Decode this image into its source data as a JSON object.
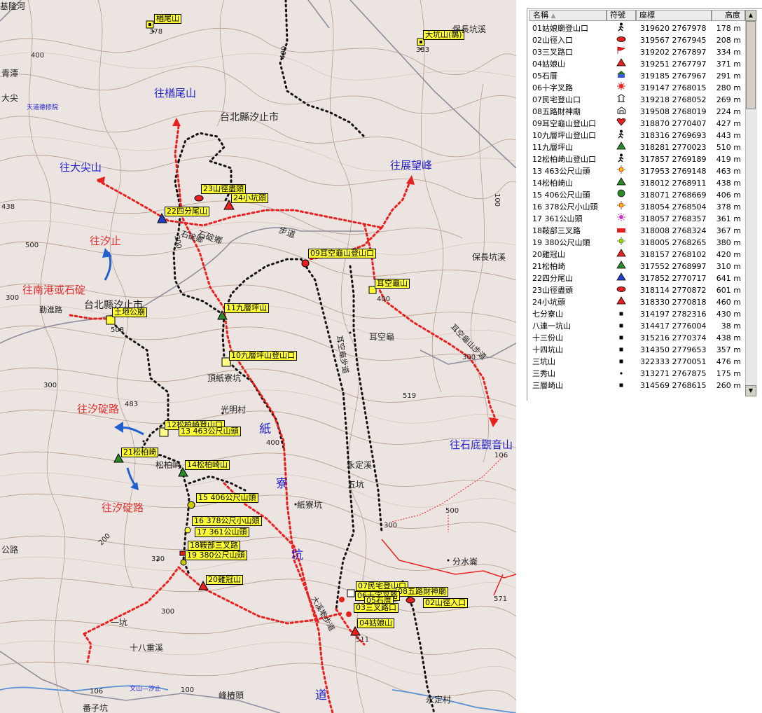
{
  "map": {
    "region_labels": [
      "台北縣汐止市",
      "台北縣汐止市",
      "石碇鄉"
    ],
    "places": [
      "基隆河",
      "保長坑溪",
      "保長坑溪",
      "耳空龜",
      "頂紙寮坑",
      "光明村",
      "松柏崎",
      "永定溪",
      "五坑",
      "紙寮坑",
      "分水崙",
      "十八重溪",
      "峰樁頭",
      "番子坑",
      "永定村",
      "一坑",
      "勤進路",
      "公路",
      "大尖",
      "青潭",
      "步道",
      "石碇鄉",
      "耳空龜步道",
      "大溪墘步道",
      "耳空龜山步道",
      "天道德修院",
      "文山—汐止"
    ],
    "directions": [
      {
        "text": "往楢尾山",
        "color": "blue"
      },
      {
        "text": "往大尖山",
        "color": "blue"
      },
      {
        "text": "往展望峰",
        "color": "blue"
      },
      {
        "text": "往汐止",
        "color": "red"
      },
      {
        "text": "往南港或石碇",
        "color": "red"
      },
      {
        "text": "往汐碇路",
        "color": "red"
      },
      {
        "text": "往汐碇路",
        "color": "red"
      },
      {
        "text": "往石底觀音山",
        "color": "blue"
      }
    ],
    "route_name_chars": [
      "紙",
      "寮",
      "坑",
      "道"
    ],
    "waypoints": [
      "楢尾山",
      "大坑山(鵠)",
      "23山徑盡頭",
      "24小坑頭",
      "22四分尾山",
      "09耳空龜山登山口",
      "耳空龜山",
      "11九層坪山",
      "10九層坪山登山口",
      "土地公廟",
      "12松柏崎登山口",
      "13 463公尺山頭",
      "21松柏崎",
      "14松柏崎山",
      "15 406公尺山頭",
      "16 378公尺小山頭",
      "17 361公山頭",
      "18鞍部三叉路",
      "19 380公尺山頭",
      "20雞冠山",
      "07民宅登山口",
      "08五路財神廟",
      "06十字叉路",
      "05石厝",
      "03三叉路口",
      "02山徑入口",
      "04姑娘山"
    ],
    "elevation_marks": [
      "378",
      "333",
      "400",
      "400",
      "300",
      "438",
      "483",
      "400",
      "500",
      "300",
      "200",
      "330",
      "300",
      "100",
      "106",
      "100",
      "106",
      "500",
      "519",
      "300",
      "400",
      "508",
      "511",
      "300",
      "571",
      "300"
    ]
  },
  "table": {
    "headers": [
      "名稱",
      "符號",
      "座標",
      "高度"
    ],
    "rows": [
      {
        "name": "01姑娘廟登山口",
        "icon": "hiker",
        "coord": "319620 2767978",
        "height": "178 m"
      },
      {
        "name": "02山徑入口",
        "icon": "red-ellipse",
        "coord": "319567 2767945",
        "height": "208 m"
      },
      {
        "name": "03三叉路口",
        "icon": "red-flag",
        "coord": "319202 2767897",
        "height": "334 m"
      },
      {
        "name": "04姑娘山",
        "icon": "red-triangle",
        "coord": "319251 2767797",
        "height": "371 m"
      },
      {
        "name": "05石厝",
        "icon": "house",
        "coord": "319185 2767967",
        "height": "291 m"
      },
      {
        "name": "06十字叉路",
        "icon": "red-star",
        "coord": "319147 2768015",
        "height": "280 m"
      },
      {
        "name": "07民宅登山口",
        "icon": "temple",
        "coord": "319218 2768052",
        "height": "269 m"
      },
      {
        "name": "08五路財神廟",
        "icon": "shrine",
        "coord": "319508 2768019",
        "height": "224 m"
      },
      {
        "name": "09耳空龜山登山口",
        "icon": "red-heart",
        "coord": "318870 2770407",
        "height": "427 m"
      },
      {
        "name": "10九層坪山登山口",
        "icon": "hiker",
        "coord": "318316 2769693",
        "height": "443 m"
      },
      {
        "name": "11九層坪山",
        "icon": "green-triangle",
        "coord": "318281 2770023",
        "height": "510 m"
      },
      {
        "name": "12松柏崎山登山口",
        "icon": "hiker",
        "coord": "317857 2769189",
        "height": "419 m"
      },
      {
        "name": "13 463公尺山頭",
        "icon": "sun",
        "coord": "317953 2769148",
        "height": "463 m"
      },
      {
        "name": "14松柏崎山",
        "icon": "green-triangle",
        "coord": "318012 2768911",
        "height": "438 m"
      },
      {
        "name": "15 406公尺山頭",
        "icon": "green-circle",
        "coord": "318071 2768669",
        "height": "406 m"
      },
      {
        "name": "16 378公尺小山頭",
        "icon": "sun",
        "coord": "318054 2768504",
        "height": "378 m"
      },
      {
        "name": "17 361公山頭",
        "icon": "purple-sun",
        "coord": "318057 2768357",
        "height": "361 m"
      },
      {
        "name": "18鞍部三叉路",
        "icon": "red-rect",
        "coord": "318008 2768324",
        "height": "367 m"
      },
      {
        "name": "19 380公尺山頭",
        "icon": "green-sun",
        "coord": "318005 2768265",
        "height": "380 m"
      },
      {
        "name": "20雞冠山",
        "icon": "red-triangle",
        "coord": "318157 2768102",
        "height": "420 m"
      },
      {
        "name": "21松柏崎",
        "icon": "green-triangle",
        "coord": "317552 2768997",
        "height": "310 m"
      },
      {
        "name": "22四分尾山",
        "icon": "blue-triangle",
        "coord": "317852 2770717",
        "height": "641 m"
      },
      {
        "name": "23山徑盡頭",
        "icon": "red-ellipse",
        "coord": "318114 2770872",
        "height": "601 m"
      },
      {
        "name": "24小坑頭",
        "icon": "red-triangle",
        "coord": "318330 2770818",
        "height": "460 m"
      },
      {
        "name": "七分寮山",
        "icon": "black-square",
        "coord": "314197 2782316",
        "height": "430 m"
      },
      {
        "name": "八連一坑山",
        "icon": "black-square",
        "coord": "314417 2776004",
        "height": "38 m"
      },
      {
        "name": "十三份山",
        "icon": "black-square",
        "coord": "315216 2770374",
        "height": "438 m"
      },
      {
        "name": "十四坑山",
        "icon": "black-square",
        "coord": "314350 2779653",
        "height": "357 m"
      },
      {
        "name": "三坑山",
        "icon": "black-square",
        "coord": "322333 2770051",
        "height": "476 m"
      },
      {
        "name": "三秀山",
        "icon": "black-dot",
        "coord": "313271 2767875",
        "height": "175 m"
      },
      {
        "name": "三層崎山",
        "icon": "black-square",
        "coord": "314569 2768615",
        "height": "260 m"
      }
    ]
  },
  "colors": {
    "route_red": "#e82020",
    "trail_black": "#111111",
    "label_yellow": "#ffff33",
    "map_bg": "#ece4e0",
    "contour": "#a08270"
  }
}
